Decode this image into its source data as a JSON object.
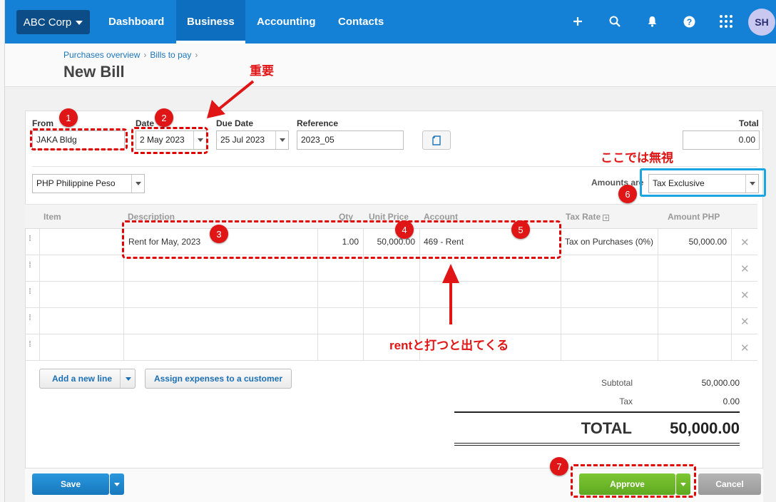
{
  "nav": {
    "org": "ABC Corp",
    "links": [
      "Dashboard",
      "Business",
      "Accounting",
      "Contacts"
    ],
    "avatar": "SH"
  },
  "breadcrumb": [
    "Purchases overview",
    "Bills to pay"
  ],
  "page_title": "New Bill",
  "form": {
    "from_label": "From",
    "from_value": "JAKA Bldg",
    "date_label": "Date",
    "date_value": "2 May 2023",
    "due_label": "Due Date",
    "due_value": "25 Jul 2023",
    "ref_label": "Reference",
    "ref_value": "2023_05",
    "total_label": "Total",
    "total_value": "0.00",
    "currency": "PHP Philippine Peso",
    "amounts_label": "Amounts are",
    "amounts_value": "Tax Exclusive"
  },
  "table": {
    "headers": [
      "Item",
      "Description",
      "Qty",
      "Unit Price",
      "Account",
      "Tax Rate",
      "Amount PHP"
    ],
    "rows": [
      {
        "item": "",
        "description": "Rent for May, 2023",
        "qty": "1.00",
        "unit_price": "50,000.00",
        "account": "469 - Rent",
        "tax_rate": "Tax on Purchases (0%)",
        "amount": "50,000.00"
      }
    ]
  },
  "buttons": {
    "add_line": "Add a new line",
    "assign": "Assign expenses to a customer",
    "save": "Save",
    "approve": "Approve",
    "cancel": "Cancel"
  },
  "summary": {
    "subtotal_label": "Subtotal",
    "subtotal": "50,000.00",
    "tax_label": "Tax",
    "tax": "0.00",
    "total_label": "TOTAL",
    "total": "50,000.00"
  },
  "annotations": {
    "important": "重要",
    "ignore": "ここでは無視",
    "rent_hint": "rentと打つと出てくる",
    "badges": [
      "1",
      "2",
      "3",
      "4",
      "5",
      "6",
      "7"
    ]
  },
  "colors": {
    "nav_bg": "#1480d6",
    "annotation_red": "#e01515",
    "highlight_blue": "#1aa4e0",
    "approve_green": "#6ab82a"
  }
}
